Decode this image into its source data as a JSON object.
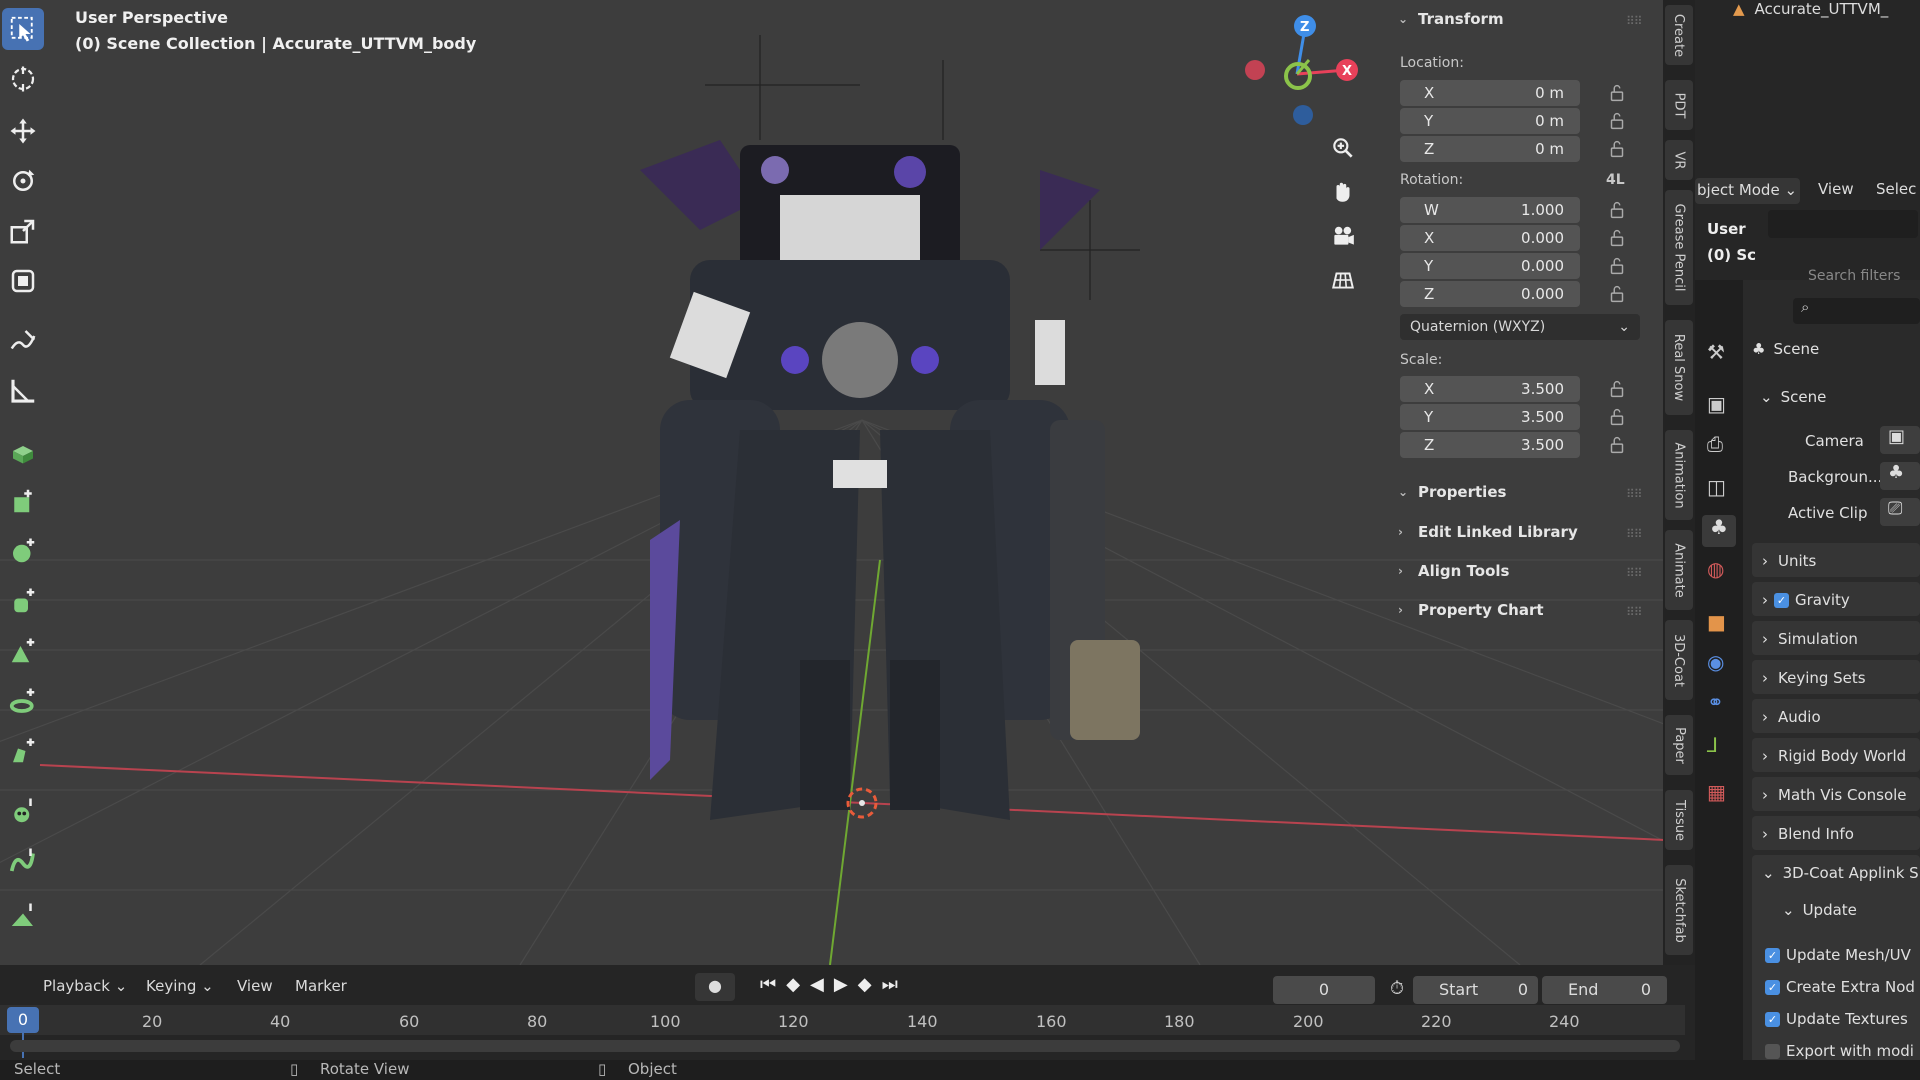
{
  "viewport": {
    "title": "User Perspective",
    "subtitle": "(0) Scene Collection | Accurate_UTTVM_body",
    "gizmo_axes": [
      "Z",
      "X"
    ]
  },
  "toolbar": {
    "tools": [
      "select-box-icon",
      "cursor-icon",
      "move-icon",
      "rotate-icon",
      "scale-icon",
      "transform-icon",
      "annotate-icon",
      "measure-icon",
      "add-cube-icon",
      "add-cube-icon",
      "add-sphere-icon",
      "add-cylinder-icon",
      "add-cone-icon",
      "add-torus-icon",
      "add-shape-icon",
      "add-monkey-icon",
      "add-curve-icon",
      "add-mesh-icon"
    ]
  },
  "transform": {
    "header": "Transform",
    "location_label": "Location:",
    "location": [
      {
        "axis": "X",
        "value": "0 m"
      },
      {
        "axis": "Y",
        "value": "0 m"
      },
      {
        "axis": "Z",
        "value": "0 m"
      }
    ],
    "rotation_label": "Rotation:",
    "rotation_badge": "4L",
    "rotation": [
      {
        "axis": "W",
        "value": "1.000"
      },
      {
        "axis": "X",
        "value": "0.000"
      },
      {
        "axis": "Y",
        "value": "0.000"
      },
      {
        "axis": "Z",
        "value": "0.000"
      }
    ],
    "rotation_mode": "Quaternion (WXYZ)",
    "scale_label": "Scale:",
    "scale": [
      {
        "axis": "X",
        "value": "3.500"
      },
      {
        "axis": "Y",
        "value": "3.500"
      },
      {
        "axis": "Z",
        "value": "3.500"
      }
    ]
  },
  "npanel_sections": [
    "Properties",
    "Edit Linked Library",
    "Align Tools",
    "Property Chart"
  ],
  "vertical_tabs": [
    "Create",
    "PDT",
    "VR",
    "Grease Pencil",
    "Real Snow",
    "Animation",
    "Animate",
    "3D-Coat",
    "Paper",
    "Tissue",
    "Sketchfab"
  ],
  "outliner": {
    "top_item": "Accurate_UTTVM_",
    "mode": "bject Mode",
    "view": "View",
    "select": "Selec",
    "user": "User",
    "collection": "(0) Sc",
    "search_placeholder": "Search filters"
  },
  "properties": {
    "header": "Scene",
    "panel": "Scene",
    "camera_label": "Camera",
    "background_label": "Backgroun...",
    "active_clip_label": "Active Clip",
    "sections": [
      "Units",
      "Gravity",
      "Simulation",
      "Keying Sets",
      "Audio",
      "Rigid Body World",
      "Math Vis Console",
      "Blend Info",
      "3D-Coat Applink S"
    ],
    "update_label": "Update",
    "checks": [
      "Update Mesh/UV",
      "Create Extra Nod",
      "Update Textures",
      "Export with modi"
    ]
  },
  "timeline": {
    "menus": [
      "Playback",
      "Keying",
      "View",
      "Marker"
    ],
    "current_frame": "0",
    "start_label": "Start",
    "start_value": "0",
    "end_label": "End",
    "end_value": "0",
    "frame_badge": "0",
    "ticks": [
      "20",
      "40",
      "60",
      "80",
      "100",
      "120",
      "140",
      "160",
      "180",
      "200",
      "220",
      "240"
    ]
  },
  "statusbar": {
    "select": "Select",
    "rotate_view": "Rotate View",
    "object": "Object"
  },
  "colors": {
    "accent": "#4772b3",
    "x_axis": "#e8415a",
    "y_axis": "#8bc34a",
    "z_axis": "#3f8ee8"
  }
}
